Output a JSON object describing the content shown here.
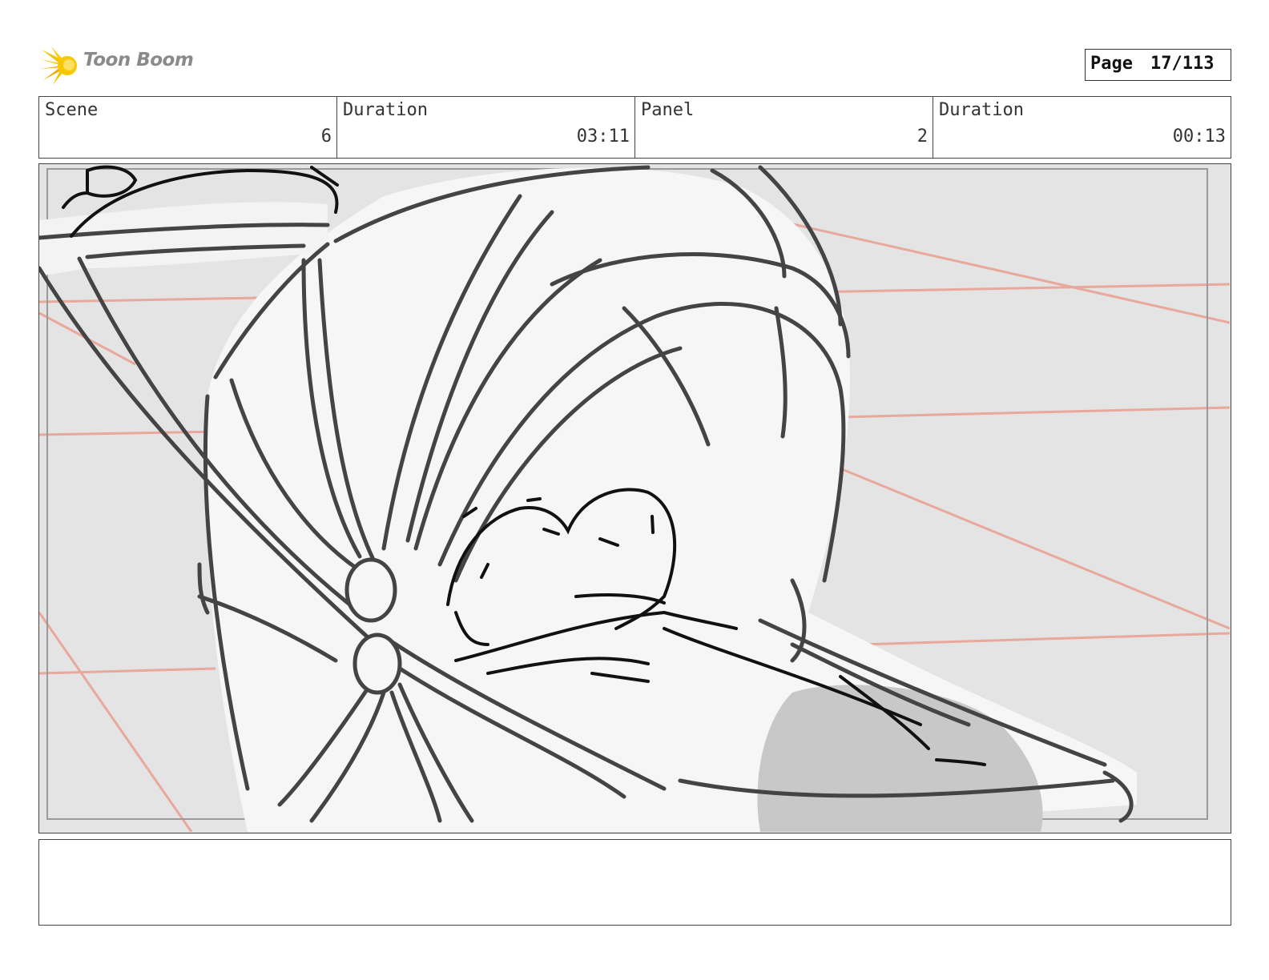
{
  "brand": {
    "name": "Toon Boom",
    "logo_icon": "starburst-icon",
    "accent": "#f5c400"
  },
  "page": {
    "label": "Page",
    "number": "17/113"
  },
  "header": {
    "scene": {
      "label": "Scene",
      "value": "6"
    },
    "scene_duration": {
      "label": "Duration",
      "value": "03:11"
    },
    "panel": {
      "label": "Panel",
      "value": "2"
    },
    "panel_duration": {
      "label": "Duration",
      "value": "00:13"
    }
  },
  "notes": {
    "text": ""
  }
}
